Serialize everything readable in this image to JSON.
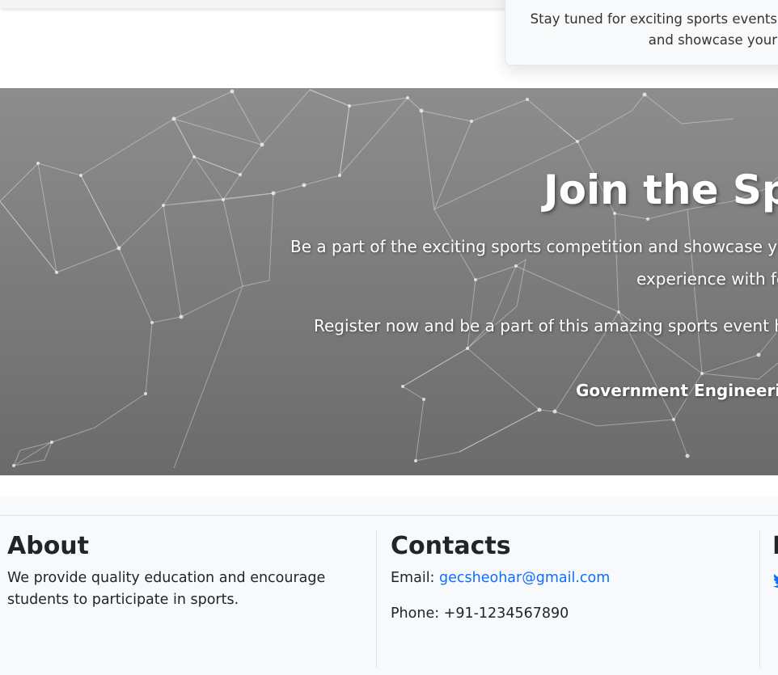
{
  "event_card": {
    "text": "Stay tuned for exciting sports events and showcase your"
  },
  "hero": {
    "title": "Join the Sports",
    "line1": "Be a part of the exciting sports competition and showcase your",
    "line2": "experience with fe",
    "line3": "Register now and be a part of this amazing sports event ha",
    "college": "Government Engineering"
  },
  "footer": {
    "about": {
      "title": "About",
      "text": "We provide quality education and encourage students to participate in sports."
    },
    "contacts": {
      "title": "Contacts",
      "email_label": "Email:",
      "email": "gecsheohar@gmail.com",
      "phone": "Phone: +91-1234567890"
    },
    "follow": {
      "title_fragment": "F",
      "icon": "twitter-icon"
    }
  },
  "colors": {
    "link": "#0d6efd",
    "footer_bg": "#f8f9fa",
    "hero_bg": "#808080"
  }
}
